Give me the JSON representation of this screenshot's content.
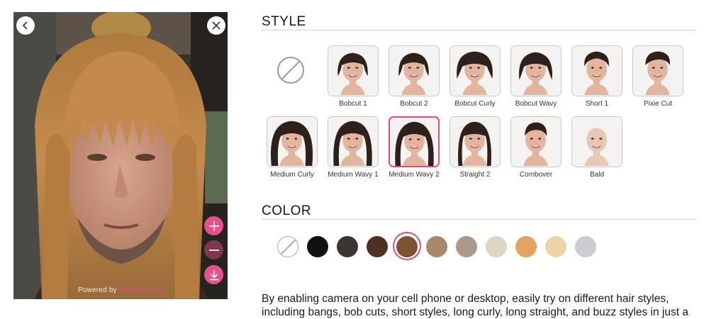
{
  "preview": {
    "powered_by": "Powered by",
    "brand": "PERFECT",
    "back_icon": "chevron-left-icon",
    "close_icon": "close-icon",
    "zoom_in_icon": "plus-icon",
    "zoom_out_icon": "minus-icon",
    "download_icon": "download-icon"
  },
  "style": {
    "title": "STYLE",
    "none_icon": "no-style-icon",
    "items": [
      {
        "label": "Bobcut 1",
        "hair": "bob"
      },
      {
        "label": "Bobcut 2",
        "hair": "bob"
      },
      {
        "label": "Bobcut Curly",
        "hair": "curly-bob"
      },
      {
        "label": "Bobcut Wavy",
        "hair": "wavy-bob"
      },
      {
        "label": "Short 1",
        "hair": "short"
      },
      {
        "label": "Pixie Cut",
        "hair": "pixie"
      },
      {
        "label": "Medium Curly",
        "hair": "medium-curly"
      },
      {
        "label": "Medium Wavy 1",
        "hair": "medium-wavy"
      },
      {
        "label": "Medium Wavy 2",
        "hair": "medium-wavy",
        "selected": true
      },
      {
        "label": "Straight 2",
        "hair": "straight"
      },
      {
        "label": "Combover",
        "hair": "combover"
      },
      {
        "label": "Bald",
        "hair": "bald"
      }
    ]
  },
  "color": {
    "title": "COLOR",
    "swatches": [
      {
        "name": "none",
        "hex": "#ffffff"
      },
      {
        "name": "black",
        "hex": "#0f1113"
      },
      {
        "name": "dark-brown",
        "hex": "#3d3533"
      },
      {
        "name": "chocolate",
        "hex": "#4e3022"
      },
      {
        "name": "medium-brown",
        "hex": "#7b5431",
        "selected": true
      },
      {
        "name": "light-brown",
        "hex": "#a8876a"
      },
      {
        "name": "ash-brown",
        "hex": "#ad9989"
      },
      {
        "name": "platinum",
        "hex": "#ddd5c4"
      },
      {
        "name": "golden",
        "hex": "#e3a462"
      },
      {
        "name": "honey-blonde",
        "hex": "#eed3a6"
      },
      {
        "name": "silver",
        "hex": "#cbcdd1"
      }
    ]
  },
  "description": "By enabling camera on your cell phone or desktop, easily try on different hair styles, including bangs, bob cuts, short styles, long curly, long straight, and buzz styles in just a"
}
